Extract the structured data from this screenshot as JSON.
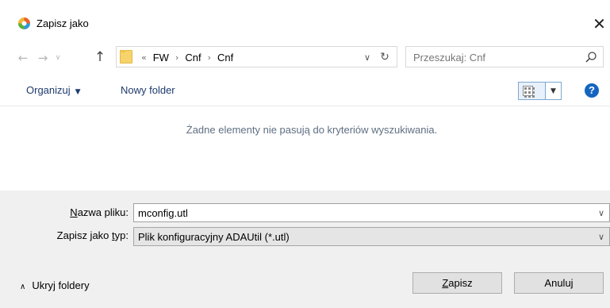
{
  "window": {
    "title": "Zapisz jako",
    "close_glyph": "✕"
  },
  "nav": {
    "back_glyph": "←",
    "forward_glyph": "→",
    "recent_glyph": "∨",
    "up_glyph": "↑",
    "breadcrumb_overflow": "«",
    "breadcrumb": [
      "FW",
      "Cnf",
      "Cnf"
    ],
    "crumb_separator": "›",
    "address_dropdown_glyph": "∨",
    "refresh_glyph": "↻"
  },
  "search": {
    "placeholder": "Przeszukaj: Cnf"
  },
  "toolbar": {
    "organize_label": "Organizuj",
    "organize_caret": "▼",
    "new_folder_label": "Nowy folder",
    "view_dropdown_glyph": "▼",
    "help_glyph": "?"
  },
  "content": {
    "empty_message": "Żadne elementy nie pasują do kryteriów wyszukiwania."
  },
  "form": {
    "filename_label_access": "N",
    "filename_label_rest": "azwa pliku:",
    "filename_value": "mconfig.utl",
    "filetype_label_pre": "Zapisz jako ",
    "filetype_label_access": "t",
    "filetype_label_rest": "yp:",
    "filetype_value": "Plik konfiguracyjny ADAUtil (*.utl)",
    "dropdown_glyph": "∨"
  },
  "footer": {
    "hide_folders_glyph": "∧",
    "hide_folders_label": "Ukryj foldery",
    "save_access": "Z",
    "save_rest": "apisz",
    "cancel_label": "Anuluj"
  },
  "colors": {
    "accent": "#1565c0",
    "toolbar_text": "#1e3a6e",
    "footer_bg": "#f0f0f0",
    "empty_text": "#5f6f82"
  }
}
